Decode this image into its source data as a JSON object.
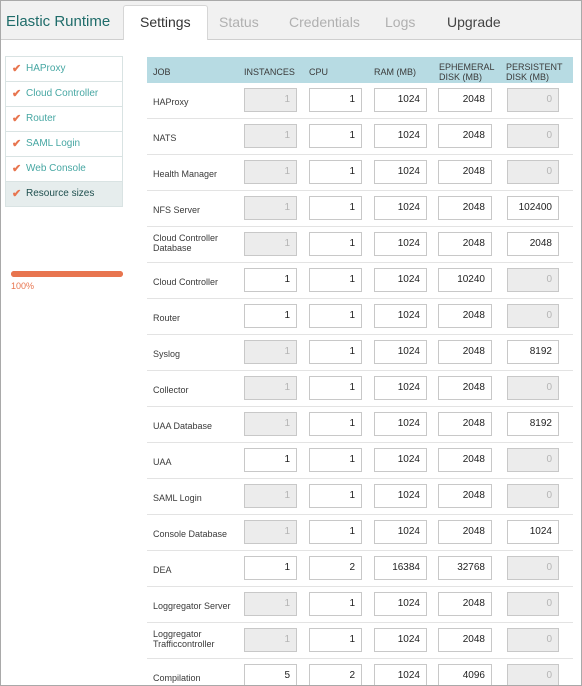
{
  "app": {
    "title": "Elastic Runtime"
  },
  "tabs": [
    {
      "label": "Settings",
      "state": "active"
    },
    {
      "label": "Status",
      "state": "disabled"
    },
    {
      "label": "Credentials",
      "state": "disabled"
    },
    {
      "label": "Logs",
      "state": "disabled"
    },
    {
      "label": "Upgrade",
      "state": "enabled"
    }
  ],
  "sidebar": {
    "items": [
      {
        "label": "HAProxy",
        "checked": true
      },
      {
        "label": "Cloud Controller",
        "checked": true
      },
      {
        "label": "Router",
        "checked": true
      },
      {
        "label": "SAML Login",
        "checked": true
      },
      {
        "label": "Web Console",
        "checked": true
      },
      {
        "label": "Resource sizes",
        "checked": true,
        "selected": true
      }
    ],
    "progress": {
      "value": 1.0,
      "label": "100%"
    }
  },
  "table": {
    "headers": [
      "JOB",
      "INSTANCES",
      "CPU",
      "RAM (MB)",
      "EPHEMERAL DISK (MB)",
      "PERSISTENT DISK (MB)"
    ],
    "rows": [
      {
        "job": "HAProxy",
        "instances": "1",
        "cpu": "1",
        "ram": "1024",
        "ephemeral": "2048",
        "persistent": "0",
        "instances_disabled": true,
        "persistent_disabled": true
      },
      {
        "job": "NATS",
        "instances": "1",
        "cpu": "1",
        "ram": "1024",
        "ephemeral": "2048",
        "persistent": "0",
        "instances_disabled": true,
        "persistent_disabled": true
      },
      {
        "job": "Health Manager",
        "instances": "1",
        "cpu": "1",
        "ram": "1024",
        "ephemeral": "2048",
        "persistent": "0",
        "instances_disabled": true,
        "persistent_disabled": true
      },
      {
        "job": "NFS Server",
        "instances": "1",
        "cpu": "1",
        "ram": "1024",
        "ephemeral": "2048",
        "persistent": "102400",
        "instances_disabled": true,
        "persistent_disabled": false
      },
      {
        "job": "Cloud Controller Database",
        "instances": "1",
        "cpu": "1",
        "ram": "1024",
        "ephemeral": "2048",
        "persistent": "2048",
        "instances_disabled": true,
        "persistent_disabled": false
      },
      {
        "job": "Cloud Controller",
        "instances": "1",
        "cpu": "1",
        "ram": "1024",
        "ephemeral": "10240",
        "persistent": "0",
        "instances_disabled": false,
        "persistent_disabled": true
      },
      {
        "job": "Router",
        "instances": "1",
        "cpu": "1",
        "ram": "1024",
        "ephemeral": "2048",
        "persistent": "0",
        "instances_disabled": false,
        "persistent_disabled": true
      },
      {
        "job": "Syslog",
        "instances": "1",
        "cpu": "1",
        "ram": "1024",
        "ephemeral": "2048",
        "persistent": "8192",
        "instances_disabled": true,
        "persistent_disabled": false
      },
      {
        "job": "Collector",
        "instances": "1",
        "cpu": "1",
        "ram": "1024",
        "ephemeral": "2048",
        "persistent": "0",
        "instances_disabled": true,
        "persistent_disabled": true
      },
      {
        "job": "UAA Database",
        "instances": "1",
        "cpu": "1",
        "ram": "1024",
        "ephemeral": "2048",
        "persistent": "8192",
        "instances_disabled": true,
        "persistent_disabled": false
      },
      {
        "job": "UAA",
        "instances": "1",
        "cpu": "1",
        "ram": "1024",
        "ephemeral": "2048",
        "persistent": "0",
        "instances_disabled": false,
        "persistent_disabled": true
      },
      {
        "job": "SAML Login",
        "instances": "1",
        "cpu": "1",
        "ram": "1024",
        "ephemeral": "2048",
        "persistent": "0",
        "instances_disabled": true,
        "persistent_disabled": true
      },
      {
        "job": "Console Database",
        "instances": "1",
        "cpu": "1",
        "ram": "1024",
        "ephemeral": "2048",
        "persistent": "1024",
        "instances_disabled": true,
        "persistent_disabled": false
      },
      {
        "job": "DEA",
        "instances": "1",
        "cpu": "2",
        "ram": "16384",
        "ephemeral": "32768",
        "persistent": "0",
        "instances_disabled": false,
        "persistent_disabled": true
      },
      {
        "job": "Loggregator Server",
        "instances": "1",
        "cpu": "1",
        "ram": "1024",
        "ephemeral": "2048",
        "persistent": "0",
        "instances_disabled": true,
        "persistent_disabled": true
      },
      {
        "job": "Loggregator Trafficcontroller",
        "instances": "1",
        "cpu": "1",
        "ram": "1024",
        "ephemeral": "2048",
        "persistent": "0",
        "instances_disabled": true,
        "persistent_disabled": true
      },
      {
        "job": "Compilation",
        "instances": "5",
        "cpu": "2",
        "ram": "1024",
        "ephemeral": "4096",
        "persistent": "0",
        "instances_disabled": false,
        "persistent_disabled": true
      }
    ]
  },
  "colors": {
    "accent": "#e8754f",
    "title": "#1f6c6a",
    "sidebar_link": "#47a7a3",
    "table_header": "#b7dbe3",
    "disabled_field": "#ececec"
  }
}
